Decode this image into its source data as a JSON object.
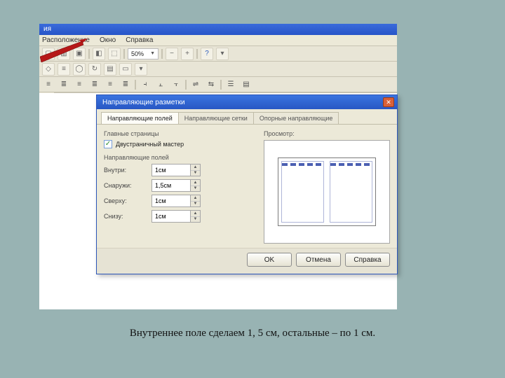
{
  "partial_title": "ия",
  "menu": {
    "arrangement": "Расположение",
    "window": "Окно",
    "help": "Справка"
  },
  "toolbar": {
    "zoom": "50%"
  },
  "dialog": {
    "title": "Направляющие разметки",
    "tabs": {
      "t1": "Направляющие полей",
      "t2": "Направляющие сетки",
      "t3": "Опорные направляющие"
    },
    "group_main": "Главные страницы",
    "checkbox": "Двустраничный мастер",
    "group_margins": "Направляющие полей",
    "fields": {
      "inner_label": "Внутри:",
      "outer_label": "Снаружи:",
      "top_label": "Сверху:",
      "bottom_label": "Снизу:",
      "inner_val": "1см",
      "outer_val": "1,5см",
      "top_val": "1см",
      "bottom_val": "1см"
    },
    "preview_label": "Просмотр:",
    "buttons": {
      "ok": "OK",
      "cancel": "Отмена",
      "help": "Справка"
    }
  },
  "caption": "Внутреннее поле сделаем 1, 5 см, остальные –  по 1 см."
}
